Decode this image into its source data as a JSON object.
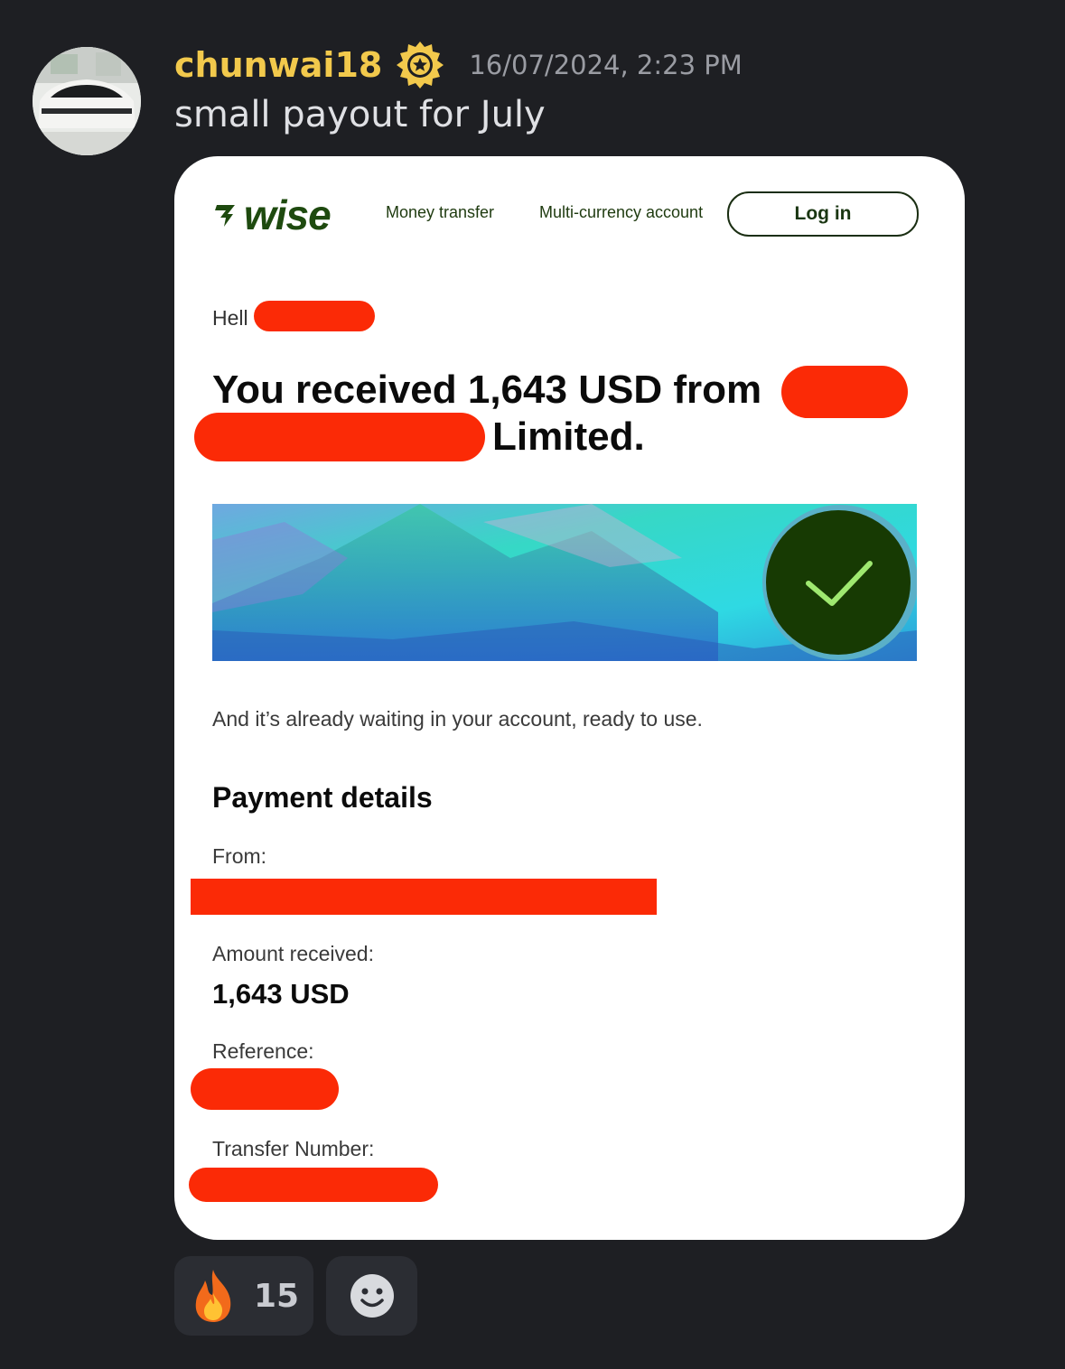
{
  "message": {
    "username": "chunwai18",
    "timestamp": "16/07/2024, 2:23 PM",
    "text": "small payout for July",
    "username_color": "#f2c94c",
    "badge_icon": "star-badge-icon"
  },
  "email": {
    "brand": {
      "flag": "\u0005F7",
      "name": "wise",
      "color": "#1e4a0f"
    },
    "nav": {
      "money_transfer": "Money transfer",
      "multi_currency": "Multi-currency account",
      "login": "Log in"
    },
    "greeting": "Hell",
    "headline": "You received 1,643 USD from",
    "headline_end": "Limited.",
    "body": "And it’s already waiting in your account, ready to use.",
    "details_title": "Payment details",
    "details": {
      "from_label": "From:",
      "amount_label": "Amount received:",
      "amount_value": "1,643 USD",
      "reference_label": "Reference:",
      "transfer_label": "Transfer Number:"
    },
    "redaction_color": "#fb2a06",
    "check_color": "#9fe870"
  },
  "reactions": [
    {
      "emoji": "🔥",
      "count": "15"
    }
  ]
}
